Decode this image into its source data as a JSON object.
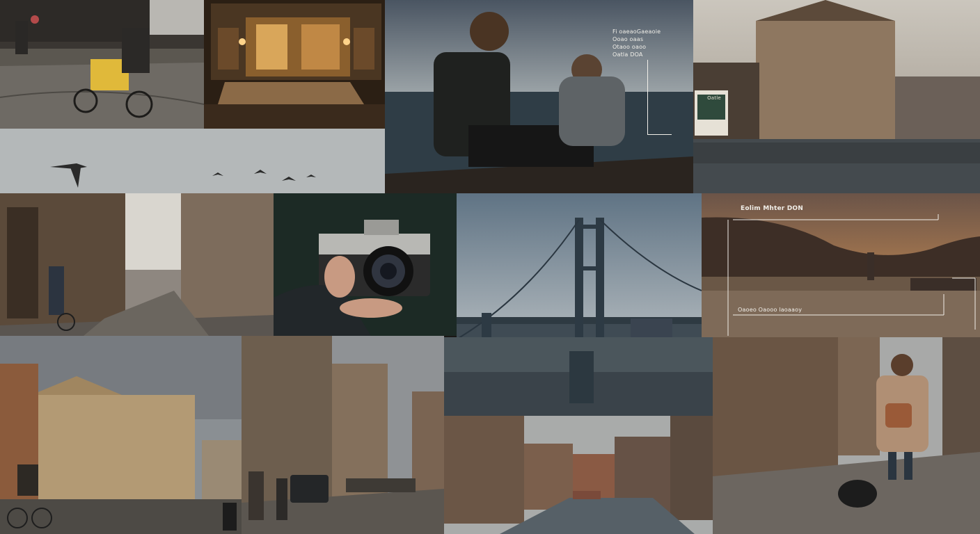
{
  "collage": {
    "tiles": [
      {
        "name": "cyclist-street-photo"
      },
      {
        "name": "lit-shopfront-photo"
      },
      {
        "name": "backpackers-sea-photo"
      },
      {
        "name": "riverside-mansion-photo"
      },
      {
        "name": "flying-birds-photo"
      },
      {
        "name": "old-town-street-photo"
      },
      {
        "name": "camera-in-hand-photo"
      },
      {
        "name": "suspension-bridge-photo"
      },
      {
        "name": "harbor-sunset-photo"
      },
      {
        "name": "baroque-square-photo"
      },
      {
        "name": "narrow-street-photo"
      },
      {
        "name": "canal-buildings-photo"
      },
      {
        "name": "walking-woman-dog-photo"
      }
    ],
    "overlays": {
      "sea_lines": [
        "Fi oaeaoGaeaoie",
        "Ooao oaas",
        "Otaoo oaoo",
        "Oatla DOA"
      ],
      "sign_text": "Oatle",
      "harbor_title": "Eolim Mhter DON",
      "harbor_caption": "Oaoeo Oaooo laoaaoy"
    }
  }
}
